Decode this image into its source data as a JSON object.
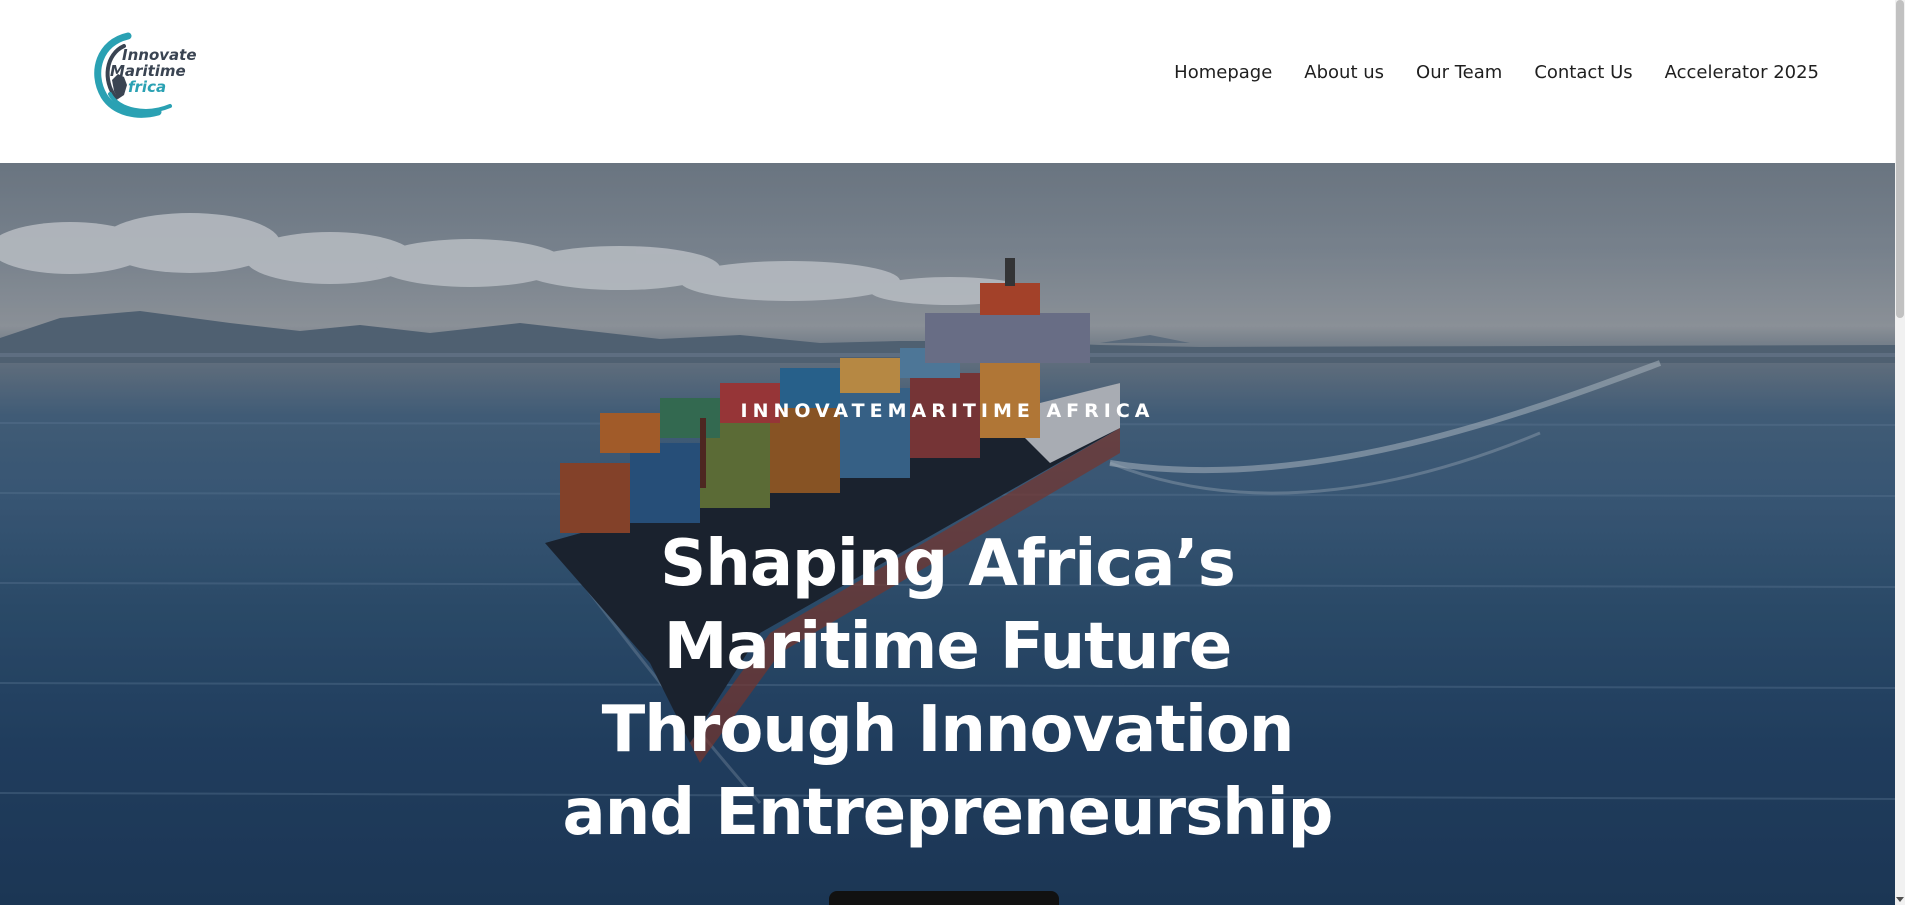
{
  "header": {
    "logo": {
      "lines": [
        "Innovate",
        "Maritime",
        "frica"
      ],
      "icon": "innovate-maritime-africa-logo",
      "colors": {
        "teal": "#2aa1b3",
        "dark": "#3a4452"
      }
    },
    "nav": [
      {
        "label": "Homepage"
      },
      {
        "label": "About us"
      },
      {
        "label": "Our Team"
      },
      {
        "label": "Contact Us"
      },
      {
        "label": "Accelerator 2025"
      }
    ]
  },
  "hero": {
    "eyebrow": "INNOVATEMARITIME AFRICA",
    "headline_lines": [
      "Shaping Africa’s",
      "Maritime Future",
      "Through Innovation",
      "and Entrepreneurship"
    ],
    "background": "container-ship-at-sea-photo"
  },
  "colors": {
    "header_bg": "#ffffff",
    "nav_text": "#1f1f1f",
    "hero_text": "#ffffff",
    "cta_bg": "#111111"
  }
}
